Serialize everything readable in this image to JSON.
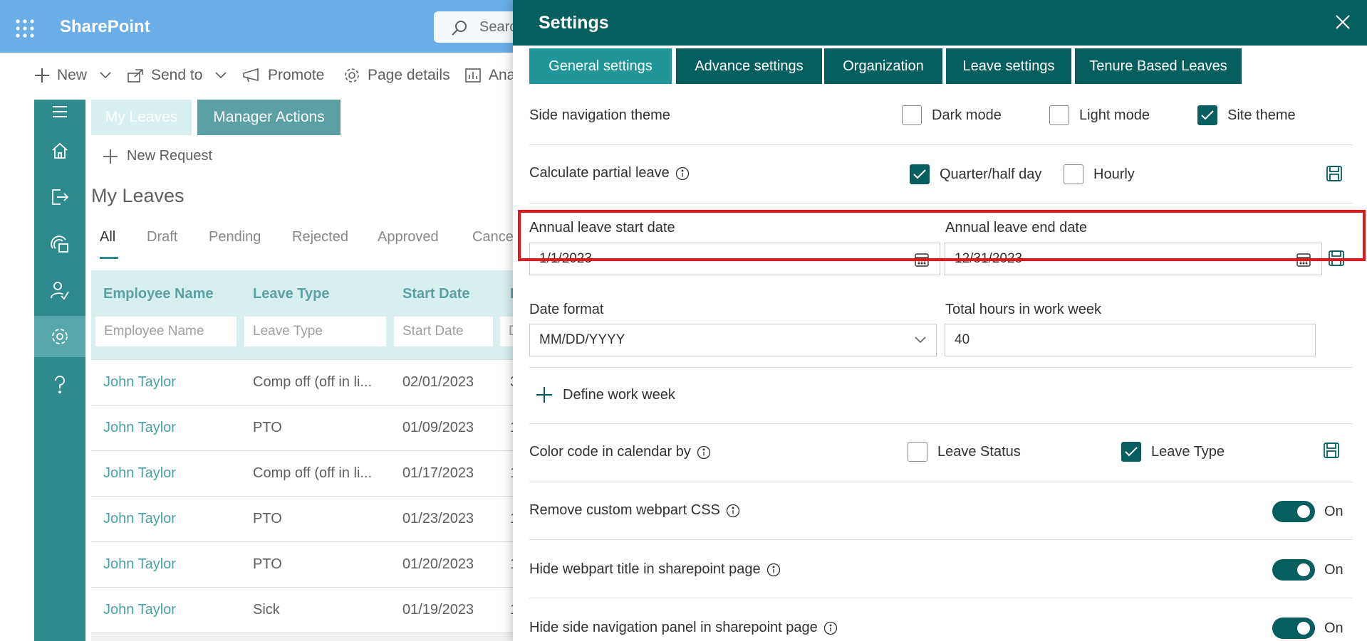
{
  "app": {
    "brand": "SharePoint",
    "search_placeholder": "Search"
  },
  "commandbar": [
    {
      "label": "New",
      "icon": "plus-icon",
      "has_menu": true
    },
    {
      "label": "Send to",
      "icon": "share-icon",
      "has_menu": true
    },
    {
      "label": "Promote",
      "icon": "megaphone-icon",
      "has_menu": false
    },
    {
      "label": "Page details",
      "icon": "gear-icon",
      "has_menu": false
    },
    {
      "label": "Ana",
      "icon": "analytics-icon",
      "has_menu": false
    }
  ],
  "sidenav": [
    "menu-icon",
    "home-icon",
    "leave-icon",
    "calendar-icon",
    "approval-icon",
    "settings-icon",
    "help-icon"
  ],
  "page": {
    "pivots": {
      "my_leaves": "My Leaves",
      "manager_actions": "Manager Actions"
    },
    "new_request": "New Request",
    "title": "My Leaves",
    "tabs": [
      "All",
      "Draft",
      "Pending",
      "Rejected",
      "Approved",
      "Cance"
    ],
    "columns": [
      "Employee Name",
      "Leave Type",
      "Start Date",
      "E"
    ],
    "filters": [
      "Employee Name",
      "Leave Type",
      "Start Date",
      "D"
    ],
    "rows": [
      {
        "name": "John Taylor",
        "type": "Comp off (off in li...",
        "start": "02/01/2023",
        "end": "3"
      },
      {
        "name": "John Taylor",
        "type": "PTO",
        "start": "01/09/2023",
        "end": "1"
      },
      {
        "name": "John Taylor",
        "type": "Comp off (off in li...",
        "start": "01/17/2023",
        "end": "1"
      },
      {
        "name": "John Taylor",
        "type": "PTO",
        "start": "01/23/2023",
        "end": "1"
      },
      {
        "name": "John Taylor",
        "type": "PTO",
        "start": "01/20/2023",
        "end": "1"
      },
      {
        "name": "John Taylor",
        "type": "Sick",
        "start": "01/19/2023",
        "end": "1"
      }
    ]
  },
  "settings": {
    "title": "Settings",
    "tabs": [
      "General settings",
      "Advance settings",
      "Organization",
      "Leave settings",
      "Tenure Based Leaves"
    ],
    "selected_tab": "General settings",
    "side_nav_theme": {
      "label": "Side navigation theme",
      "options": [
        {
          "label": "Dark mode",
          "checked": false
        },
        {
          "label": "Light mode",
          "checked": false
        },
        {
          "label": "Site theme",
          "checked": true
        }
      ]
    },
    "partial_leave": {
      "label": "Calculate partial leave",
      "options": [
        {
          "label": "Quarter/half day",
          "checked": true
        },
        {
          "label": "Hourly",
          "checked": false
        }
      ]
    },
    "annual_start": {
      "label": "Annual leave start date",
      "value": "1/1/2023"
    },
    "annual_end": {
      "label": "Annual leave end date",
      "value": "12/31/2023"
    },
    "date_format": {
      "label": "Date format",
      "value": "MM/DD/YYYY"
    },
    "work_hours": {
      "label": "Total hours in work week",
      "value": "40"
    },
    "define_work_week": "Define work week",
    "color_code": {
      "label": "Color code in calendar by",
      "options": [
        {
          "label": "Leave Status",
          "checked": false
        },
        {
          "label": "Leave Type",
          "checked": true
        }
      ]
    },
    "toggles": [
      {
        "label": "Remove custom webpart CSS",
        "state": "On",
        "on": true
      },
      {
        "label": "Hide webpart title in sharepoint page",
        "state": "On",
        "on": true
      },
      {
        "label": "Hide side navigation panel in sharepoint page",
        "state": "On",
        "on": true
      }
    ]
  },
  "colors": {
    "header": "#6aaee7",
    "teal_dark": "#075e5e",
    "teal_selected": "#20969a",
    "highlight": "#e5161b"
  }
}
